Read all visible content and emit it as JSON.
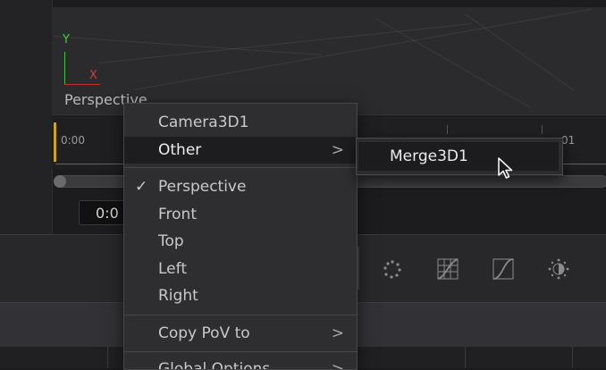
{
  "viewer": {
    "label": "Perspective",
    "axis_y": "Y",
    "axis_x": "X"
  },
  "timeline": {
    "start_time": "0:00",
    "right_time": "01",
    "timecode": "0:0"
  },
  "context_menu": {
    "items": [
      {
        "label": "Camera3D1",
        "checked": false,
        "has_submenu": false,
        "highlighted": false
      },
      {
        "label": "Other",
        "checked": false,
        "has_submenu": true,
        "highlighted": true
      },
      {
        "label": "Perspective",
        "checked": true,
        "has_submenu": false,
        "highlighted": false
      },
      {
        "label": "Front",
        "checked": false,
        "has_submenu": false,
        "highlighted": false
      },
      {
        "label": "Top",
        "checked": false,
        "has_submenu": false,
        "highlighted": false
      },
      {
        "label": "Left",
        "checked": false,
        "has_submenu": false,
        "highlighted": false
      },
      {
        "label": "Right",
        "checked": false,
        "has_submenu": false,
        "highlighted": false
      },
      {
        "label": "Copy PoV to",
        "checked": false,
        "has_submenu": true,
        "highlighted": false
      },
      {
        "label": "Global Options",
        "checked": false,
        "has_submenu": true,
        "highlighted": false
      }
    ],
    "check_glyph": "✓",
    "arrow_glyph": ">"
  },
  "submenu": {
    "items": [
      {
        "label": "Merge3D1",
        "highlighted": true
      }
    ]
  },
  "toolbar_icons": [
    "particles-icon",
    "grid-curve-icon",
    "curve-icon",
    "brightness-icon"
  ],
  "colors": {
    "menu_bg": "#2e2e31",
    "highlight_bg": "#1d1d20",
    "axis_y": "#3fcf3f",
    "axis_x": "#d33a3a",
    "playhead": "#c9a227"
  }
}
